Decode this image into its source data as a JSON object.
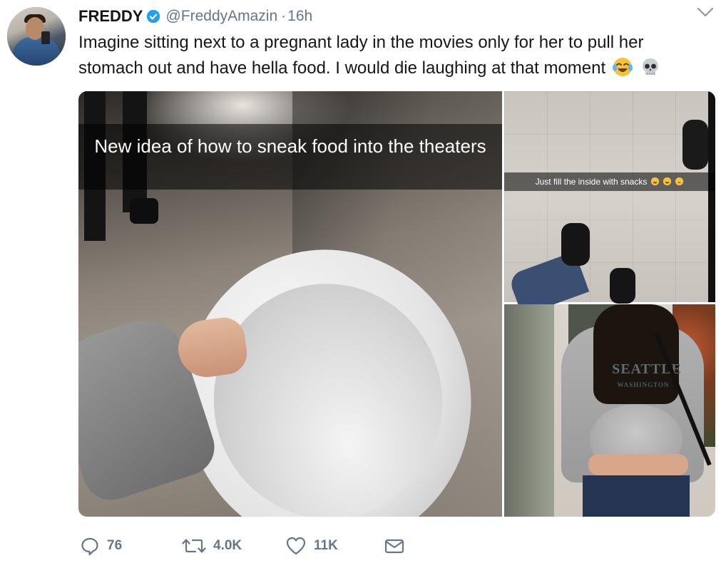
{
  "tweet": {
    "display_name": "FREDDY",
    "handle": "@FreddyAmazin",
    "separator": "·",
    "time": "16h",
    "text": "Imagine sitting next to a pregnant lady in the movies only for her to pull her stomach out and have hella food. I would die laughing at that moment",
    "emojis": [
      "face-with-tears-of-joy-icon",
      "skull-icon"
    ]
  },
  "media": {
    "photo1_caption": "New idea of how to sneak food into the theaters",
    "photo2_caption": "Just fill the inside with snacks",
    "photo3_shirt_text": "SEATTLE",
    "photo3_shirt_subtext": "WASHINGTON"
  },
  "actions": {
    "replies": "76",
    "retweets": "4.0K",
    "likes": "11K"
  },
  "colors": {
    "text": "#14171a",
    "secondary": "#657786",
    "verified": "#1da1f2"
  }
}
